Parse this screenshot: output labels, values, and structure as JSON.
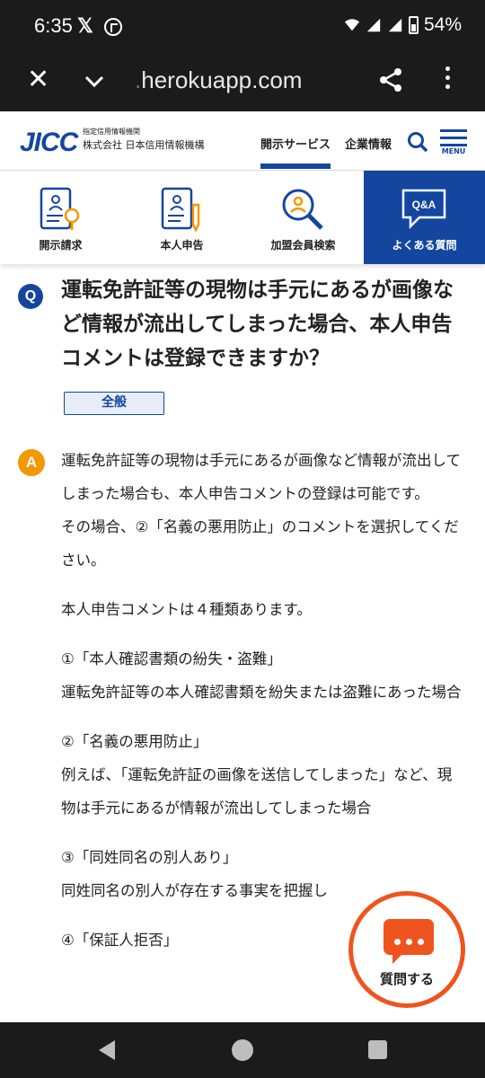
{
  "status_bar": {
    "time": "6:35",
    "x_logo": "𝕏",
    "battery": "54%"
  },
  "browser": {
    "url_faded": ".",
    "url_domain": "herokuapp.com"
  },
  "site_header": {
    "logo": "JICC",
    "logo_sub1": "指定信用情報機関",
    "logo_sub2": "株式会社 日本信用情報機構",
    "nav": [
      "開示サービス",
      "企業情報"
    ],
    "menu_label": "MENU"
  },
  "tabs": [
    {
      "label": "開示請求",
      "icon": "disclosure-request-icon",
      "active": false
    },
    {
      "label": "本人申告",
      "icon": "self-declaration-icon",
      "active": false
    },
    {
      "label": "加盟会員検索",
      "icon": "member-search-icon",
      "active": false
    },
    {
      "label": "よくある質問",
      "icon": "faq-icon",
      "active": true,
      "icon_text": "Q&A"
    }
  ],
  "question": {
    "badge": "Q",
    "text": "運転免許証等の現物は手元にあるが画像など情報が流出してしまった場合、本人申告コメントは登録できますか？",
    "tag": "全般"
  },
  "answer": {
    "badge": "A",
    "p1": "運転免許証等の現物は手元にあるが画像など情報が流出してしまった場合も、本人申告コメントの登録は可能です。",
    "p2": "その場合、②「名義の悪用防止」のコメントを選択してください。",
    "p3": "本人申告コメントは４種類あります。",
    "item1_title": "①「本人確認書類の紛失・盗難」",
    "item1_desc": "運転免許証等の本人確認書類を紛失または盗難にあった場合",
    "item2_title": "②「名義の悪用防止」",
    "item2_desc": "例えば、「運転免許証の画像を送信してしまった」など、現物は手元にあるが情報が流出してしまった場合",
    "item3_title": "③「同姓同名の別人あり」",
    "item3_desc": "同姓同名の別人が存在する事実を把握し",
    "item4_title": "④「保証人拒否」"
  },
  "fab": {
    "label": "質問する"
  },
  "colors": {
    "brand_blue": "#1446a0",
    "answer_orange": "#f39800",
    "fab_orange": "#f0541e"
  }
}
